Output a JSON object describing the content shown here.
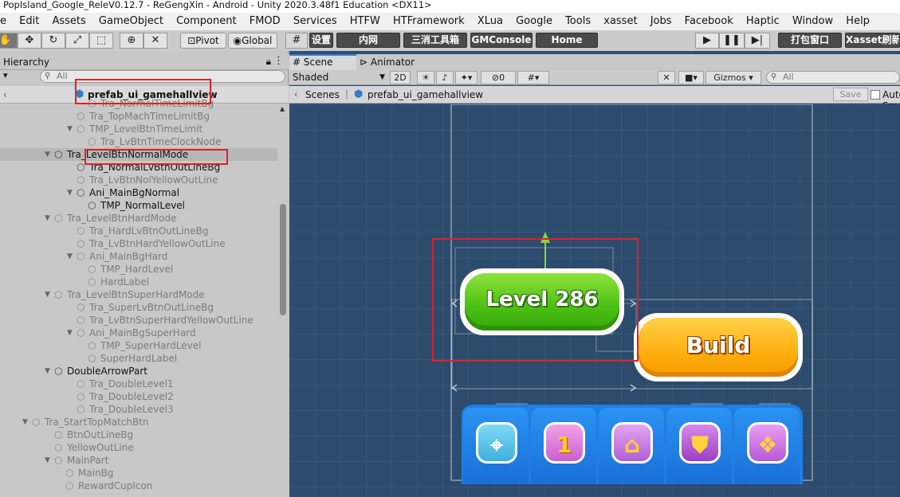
{
  "window": {
    "title": "PopIsland_Google_ReleV0.12.7 - ReGengXin - Android - Unity 2020.3.48f1 Education <DX11>"
  },
  "menu": [
    "e",
    "Edit",
    "Assets",
    "GameObject",
    "Component",
    "FMOD",
    "Services",
    "HTFW",
    "HTFramework",
    "XLua",
    "Google",
    "Tools",
    "xasset",
    "Jobs",
    "Facebook",
    "Haptic",
    "Window",
    "Help"
  ],
  "toolbar": {
    "pivot": "Pivot",
    "global": "Global",
    "settings": "设置",
    "intranet": "内网",
    "match3_toolbox": "三消工具箱",
    "gmconsole": "GMConsole",
    "home": "Home",
    "build_window": "打包窗口",
    "xasset_refresh": "Xasset刷新"
  },
  "hierarchy": {
    "tab": "Hierarchy",
    "search_placeholder": "All",
    "prefab_title": "prefab_ui_gamehallview",
    "rows": [
      {
        "label": "Tra_NormalTimeLimitBg",
        "active": false
      },
      {
        "label": "Tra_TopMachTimeLimitBg",
        "active": false
      },
      {
        "label": "TMP_LevelBtnTimeLimit",
        "active": false
      },
      {
        "label": "Tra_LvBtnTimeClockNode",
        "active": false
      },
      {
        "label": "Tra_LevelBtnNormalMode",
        "active": true
      },
      {
        "label": "Tra_NormalLvBtnOutLineBg",
        "active": true
      },
      {
        "label": "Tra_LvBtnNolYellowOutLine",
        "active": false
      },
      {
        "label": "Ani_MainBgNormal",
        "active": true
      },
      {
        "label": "TMP_NormalLevel",
        "active": true
      },
      {
        "label": "Tra_LevelBtnHardMode",
        "active": false
      },
      {
        "label": "Tra_HardLvBtnOutLineBg",
        "active": false
      },
      {
        "label": "Tra_LvBtnHardYellowOutLine",
        "active": false
      },
      {
        "label": "Ani_MainBgHard",
        "active": false
      },
      {
        "label": "TMP_HardLevel",
        "active": false
      },
      {
        "label": "HardLabel",
        "active": false
      },
      {
        "label": "Tra_LevelBtnSuperHardMode",
        "active": false
      },
      {
        "label": "Tra_SuperLvBtnOutLineBg",
        "active": false
      },
      {
        "label": "Tra_LvBtnSuperHardYellowOutLine",
        "active": false
      },
      {
        "label": "Ani_MainBgSuperHard",
        "active": false
      },
      {
        "label": "TMP_SuperHardLevel",
        "active": false
      },
      {
        "label": "SuperHardLabel",
        "active": false
      },
      {
        "label": "DoubleArrowPart",
        "active": true
      },
      {
        "label": "Tra_DoubleLevel1",
        "active": false
      },
      {
        "label": "Tra_DoubleLevel2",
        "active": false
      },
      {
        "label": "Tra_DoubleLevel3",
        "active": false
      },
      {
        "label": "Tra_StartTopMatchBtn",
        "active": false
      },
      {
        "label": "BtnOutLineBg",
        "active": false
      },
      {
        "label": "YellowOutLine",
        "active": false
      },
      {
        "label": "MainPart",
        "active": false
      },
      {
        "label": "MainBg",
        "active": false
      },
      {
        "label": "RewardCupIcon",
        "active": false
      }
    ]
  },
  "scene": {
    "tabs": [
      "Scene",
      "Animator"
    ],
    "shading": "Shaded",
    "mode_2d": "2D",
    "hidden_count": "0",
    "gizmos": "Gizmos",
    "search_placeholder": "All",
    "breadcrumb_root": "Scenes",
    "breadcrumb_prefab": "prefab_ui_gamehallview",
    "save": "Save",
    "auto_save": "Auto Save"
  },
  "game": {
    "level_button": "Level 286",
    "build_button": "Build",
    "nav_badge_number": "1"
  },
  "colors": {
    "scene_bg": "#2d4b6d",
    "level_green": "#4bbf13",
    "build_orange": "#ffae0e",
    "nav_blue": "#1f7fe6",
    "annotation_red": "#e02222"
  }
}
